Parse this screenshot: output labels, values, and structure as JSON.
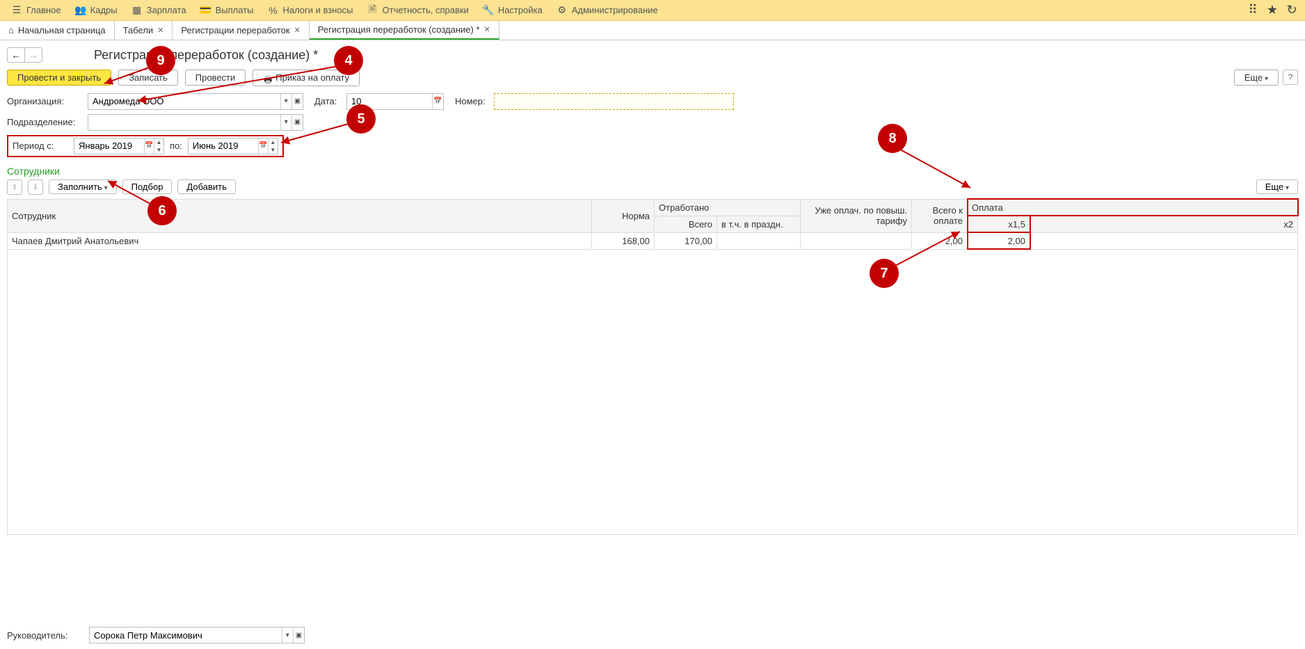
{
  "menu": {
    "items": [
      {
        "icon": "☰",
        "label": "Главное"
      },
      {
        "icon": "👥",
        "label": "Кадры"
      },
      {
        "icon": "▦",
        "label": "Зарплата"
      },
      {
        "icon": "💳",
        "label": "Выплаты"
      },
      {
        "icon": "%",
        "label": "Налоги и взносы"
      },
      {
        "icon": "🗎",
        "label": "Отчетность, справки"
      },
      {
        "icon": "🔧",
        "label": "Настройка"
      },
      {
        "icon": "⚙",
        "label": "Администрирование"
      }
    ]
  },
  "tabs": [
    {
      "icon": "⌂",
      "label": "Начальная страница",
      "closable": false
    },
    {
      "icon": "",
      "label": "Табели",
      "closable": true
    },
    {
      "icon": "",
      "label": "Регистрации переработок",
      "closable": true
    },
    {
      "icon": "",
      "label": "Регистрация переработок (создание) *",
      "closable": true,
      "active": true
    }
  ],
  "page_title": "Регистрация переработок (создание) *",
  "cmdbar": {
    "post_close": "Провести и закрыть",
    "save": "Записать",
    "post": "Провести",
    "print": "Приказ на оплату",
    "more": "Еще",
    "help": "?"
  },
  "form": {
    "org_label": "Организация:",
    "org_value": "Андромеда ООО",
    "date_label": "Дата:",
    "date_value": "10",
    "number_label": "Номер:",
    "number_value": "",
    "dept_label": "Подразделение:",
    "dept_value": "",
    "period_from_label": "Период с:",
    "period_from_value": "Январь 2019",
    "period_to_label": "по:",
    "period_to_value": "Июнь 2019"
  },
  "section_title": "Сотрудники",
  "subbar": {
    "fill": "Заполнить",
    "pick": "Подбор",
    "add": "Добавить",
    "more": "Еще"
  },
  "table": {
    "headers": {
      "employee": "Сотрудник",
      "norm": "Норма",
      "worked": "Отработано",
      "worked_total": "Всего",
      "worked_hol": "в т.ч. в праздн.",
      "already_paid": "Уже оплач. по повыш. тарифу",
      "to_pay_total": "Всего к оплате",
      "pay": "Оплата",
      "x15": "x1,5",
      "x2": "x2"
    },
    "rows": [
      {
        "employee": "Чапаев Дмитрий Анатольевич",
        "norm": "168,00",
        "worked_total": "170,00",
        "worked_hol": "",
        "already_paid": "",
        "to_pay_total": "2,00",
        "x15": "2,00",
        "x2": ""
      }
    ]
  },
  "footer": {
    "leader_label": "Руководитель:",
    "leader_value": "Сорока Петр Максимович"
  },
  "callouts": {
    "c4": "4",
    "c5": "5",
    "c6": "6",
    "c7": "7",
    "c8": "8",
    "c9": "9"
  }
}
